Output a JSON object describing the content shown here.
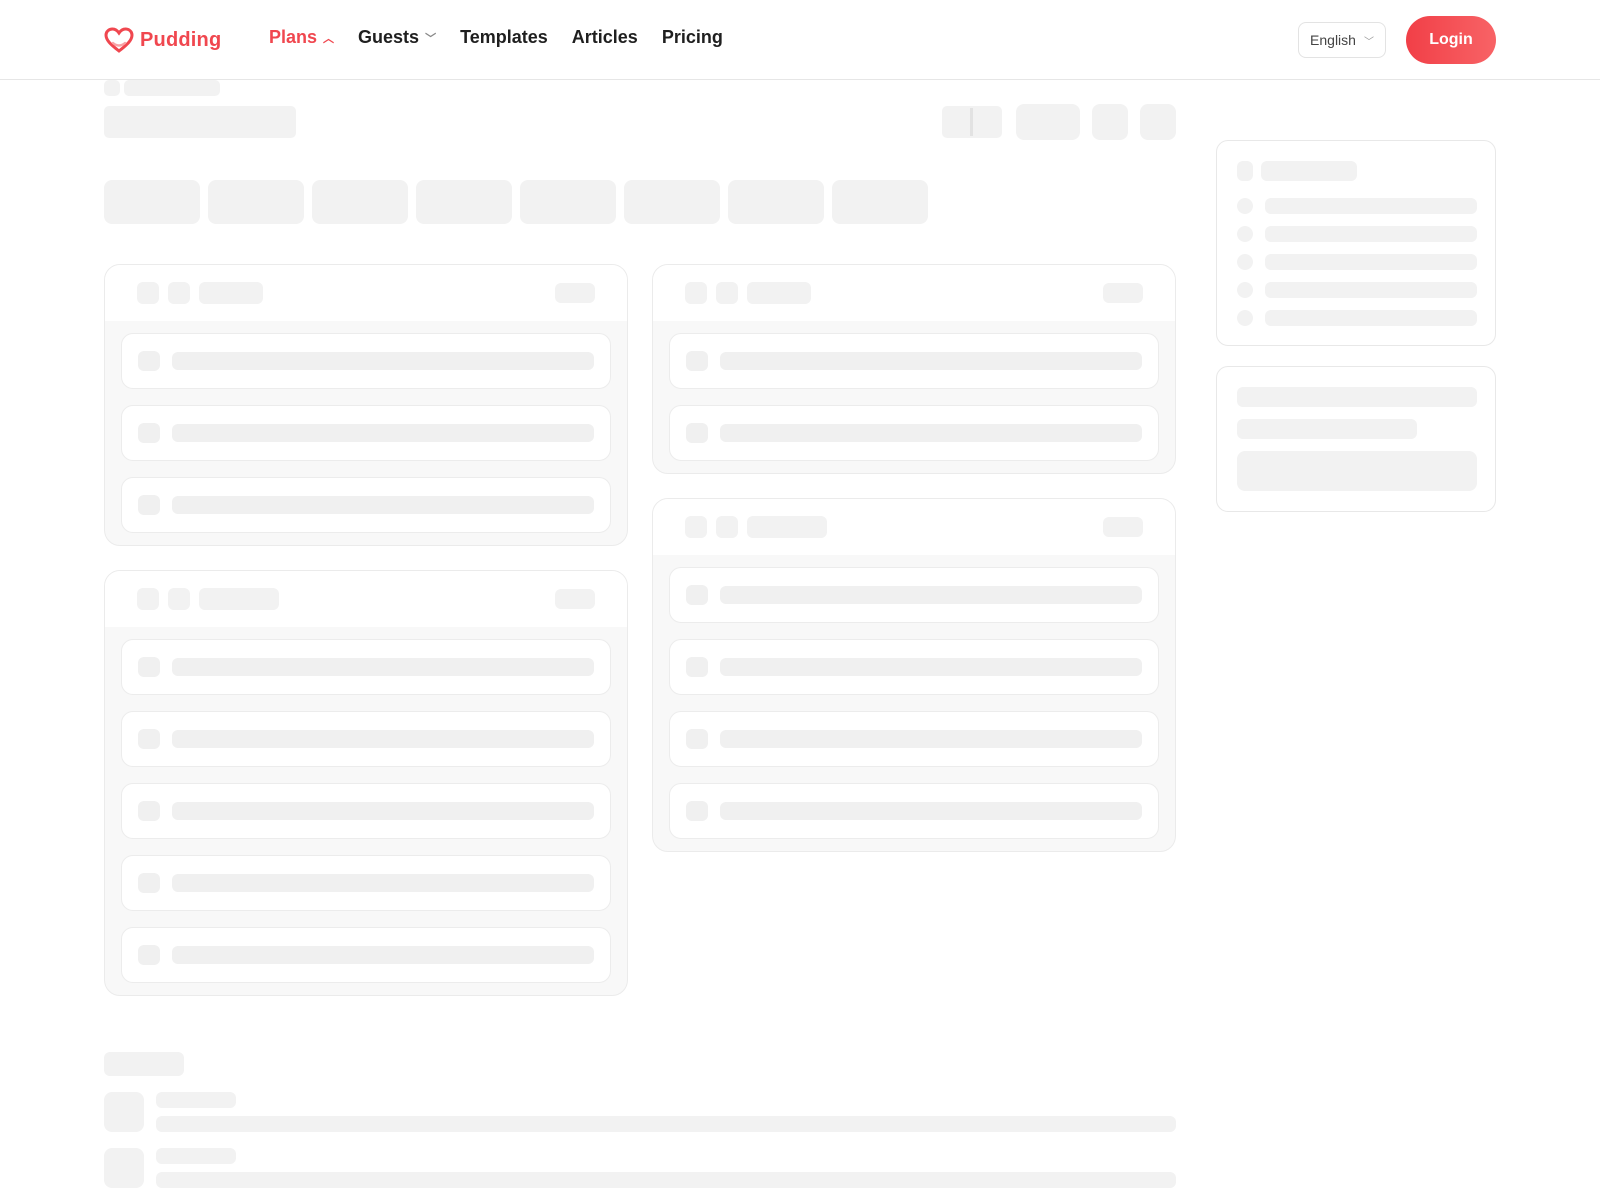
{
  "app": {
    "name": "Pudding",
    "brand_color": "#f0474f"
  },
  "nav": {
    "items": [
      {
        "label": "Plans",
        "active": true,
        "dropdown": "expanded"
      },
      {
        "label": "Guests",
        "active": false,
        "dropdown": "collapsed"
      },
      {
        "label": "Templates",
        "active": false
      },
      {
        "label": "Articles",
        "active": false
      },
      {
        "label": "Pricing",
        "active": false
      }
    ]
  },
  "language": {
    "selected": "English"
  },
  "login": {
    "label": "Login"
  },
  "state": {
    "loading": true
  }
}
